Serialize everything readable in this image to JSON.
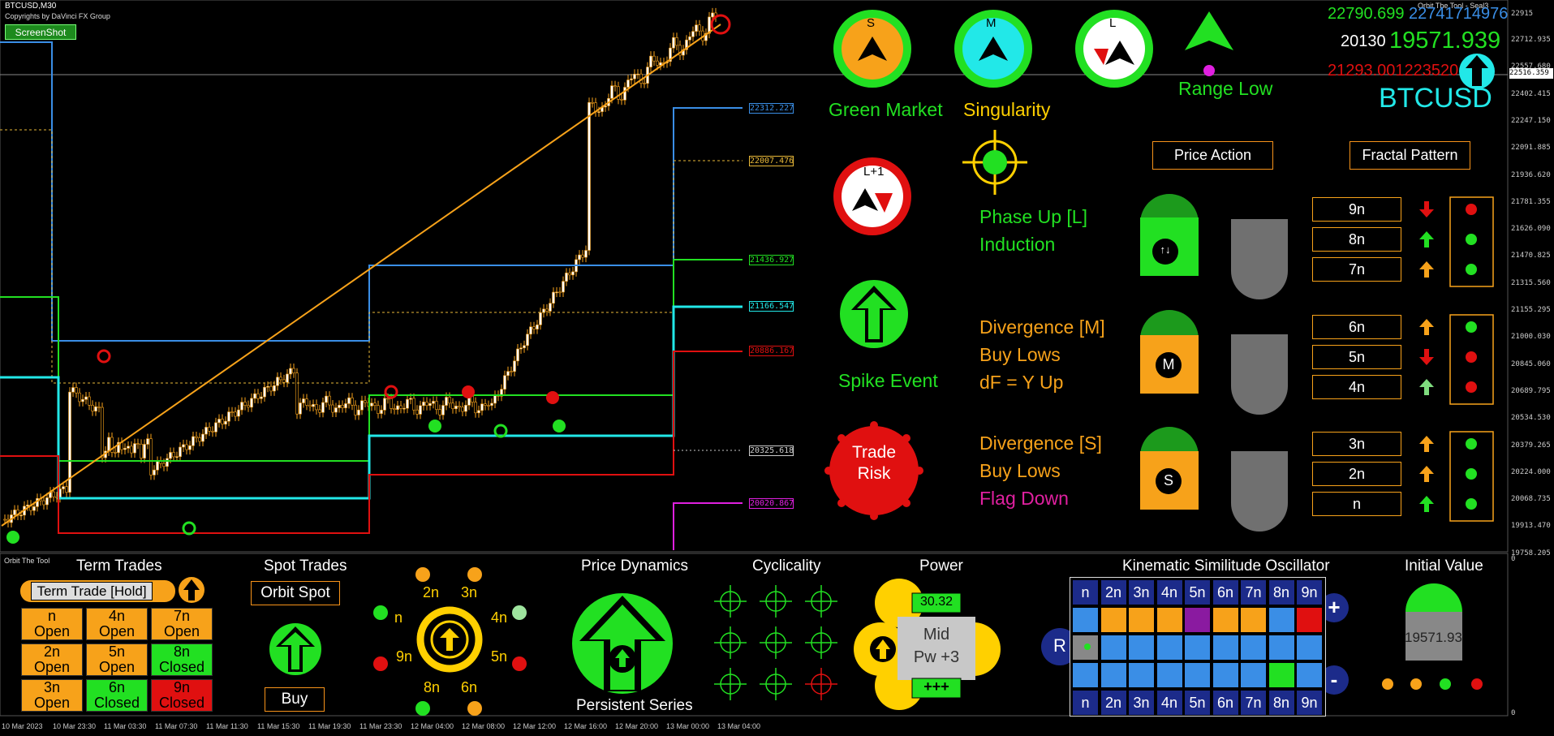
{
  "header": {
    "symbol_tf": "BTCUSD,M30",
    "copyright": "Copyrights by DaVinci FX Group",
    "screenshot_button": "ScreenShot",
    "tool_name_right": "Orbit The Tool - Seal3",
    "tool_name_bottom": "Orbit The Tool"
  },
  "price_scale": {
    "labels": [
      "22712.935",
      "22557.680",
      "22402.415",
      "22247.150",
      "22091.885",
      "21936.620",
      "21781.355",
      "21626.090",
      "21470.825",
      "21315.560",
      "21155.295",
      "21000.030",
      "20845.060",
      "20689.795",
      "20534.530",
      "20379.265",
      "20224.000",
      "20068.735",
      "19913.470",
      "19758.205"
    ],
    "top_label": "22915",
    "current_price": "22516.359",
    "sub_top": "0",
    "sub_bottom": "0"
  },
  "level_tags": [
    {
      "value": "22312.227",
      "color": "#3a8ee6"
    },
    {
      "value": "22007.476",
      "color": "#e8b838"
    },
    {
      "value": "21436.927",
      "color": "#22e022"
    },
    {
      "value": "21166.547",
      "color": "#22e8e8"
    },
    {
      "value": "20886.167",
      "color": "#e01010"
    },
    {
      "value": "20325.618",
      "color": "#cccccc"
    },
    {
      "value": "20020.867",
      "color": "#e020e0"
    }
  ],
  "time_axis": [
    "10 Mar 2023",
    "10 Mar 23:30",
    "11 Mar 03:30",
    "11 Mar 07:30",
    "11 Mar 11:30",
    "11 Mar 15:30",
    "11 Mar 19:30",
    "11 Mar 23:30",
    "12 Mar 04:00",
    "12 Mar 08:00",
    "12 Mar 12:00",
    "12 Mar 16:00",
    "12 Mar 20:00",
    "13 Mar 00:00",
    "13 Mar 04:00"
  ],
  "indicators": {
    "circle_s": "S",
    "circle_m": "M",
    "circle_l": "L",
    "circle_l1": "L+1",
    "green_market": "Green Market",
    "singularity": "Singularity",
    "range_low": "Range Low",
    "spike_event": "Spike Event",
    "trade_risk_1": "Trade",
    "trade_risk_2": "Risk"
  },
  "top_right": {
    "v1": "22790.699",
    "v2": "22741714976",
    "v3": "20130",
    "v4": "19571.939",
    "v5": "21293.001223520",
    "symbol": "BTCUSD"
  },
  "buttons": {
    "price_action": "Price Action",
    "fractal_pattern": "Fractal Pattern"
  },
  "phases": [
    {
      "line1": "Phase Up [L]",
      "line2": "Induction",
      "line3": "",
      "badge": "↑↓",
      "color": "#22e022"
    },
    {
      "line1": "Divergence [M]",
      "line2": "Buy Lows",
      "line3": "dF = Y Up",
      "badge": "M",
      "color": "#f7a21a"
    },
    {
      "line1": "Divergence [S]",
      "line2": "Buy Lows",
      "line3": "Flag Down",
      "badge": "S",
      "color": "#f7a21a"
    }
  ],
  "levels": [
    {
      "label": "9n",
      "arrow": "down",
      "arrow_color": "#e01010",
      "dot": "#e01010"
    },
    {
      "label": "8n",
      "arrow": "up",
      "arrow_color": "#22e022",
      "dot": "#22e022"
    },
    {
      "label": "7n",
      "arrow": "up",
      "arrow_color": "#f7a21a",
      "dot": "#22e022"
    },
    {
      "label": "6n",
      "arrow": "up",
      "arrow_color": "#f7a21a",
      "dot": "#22e022"
    },
    {
      "label": "5n",
      "arrow": "down",
      "arrow_color": "#e01010",
      "dot": "#e01010"
    },
    {
      "label": "4n",
      "arrow": "up",
      "arrow_color": "#7fdc7f",
      "dot": "#e01010"
    },
    {
      "label": "3n",
      "arrow": "up",
      "arrow_color": "#f7a21a",
      "dot": "#22e022"
    },
    {
      "label": "2n",
      "arrow": "up",
      "arrow_color": "#f7a21a",
      "dot": "#22e022"
    },
    {
      "label": "n",
      "arrow": "up",
      "arrow_color": "#22e022",
      "dot": "#22e022"
    }
  ],
  "bottom": {
    "term_trades": "Term Trades",
    "term_trade_btn": "Term Trade [Hold]",
    "term_cells": [
      {
        "l1": "n",
        "l2": "Open",
        "bg": "#f7a21a"
      },
      {
        "l1": "4n",
        "l2": "Open",
        "bg": "#f7a21a"
      },
      {
        "l1": "7n",
        "l2": "Open",
        "bg": "#f7a21a"
      },
      {
        "l1": "2n",
        "l2": "Open",
        "bg": "#f7a21a"
      },
      {
        "l1": "5n",
        "l2": "Open",
        "bg": "#f7a21a"
      },
      {
        "l1": "8n",
        "l2": "Closed",
        "bg": "#22e022"
      },
      {
        "l1": "3n",
        "l2": "Open",
        "bg": "#f7a21a"
      },
      {
        "l1": "6n",
        "l2": "Closed",
        "bg": "#22e022"
      },
      {
        "l1": "9n",
        "l2": "Closed",
        "bg": "#e01010"
      }
    ],
    "spot_trades": "Spot Trades",
    "orbit_spot": "Orbit Spot",
    "buy": "Buy",
    "orbit_labels": [
      "2n",
      "3n",
      "n",
      "4n",
      "9n",
      "5n",
      "8n",
      "6n"
    ],
    "price_dynamics": "Price Dynamics",
    "persistent_series": "Persistent Series",
    "cyclicality": "Cyclicality",
    "power": "Power",
    "power_value": "30.32",
    "power_mid1": "Mid",
    "power_mid2": "Pw +3",
    "power_bottom": "+++",
    "kso_title": "Kinematic Similitude Oscillator",
    "kso_labels": [
      "n",
      "2n",
      "3n",
      "4n",
      "5n",
      "6n",
      "7n",
      "8n",
      "9n"
    ],
    "kso_r": "R",
    "kso_plus": "+",
    "kso_minus": "-",
    "initial_value": "Initial Value",
    "initial_number": "19571.939"
  }
}
